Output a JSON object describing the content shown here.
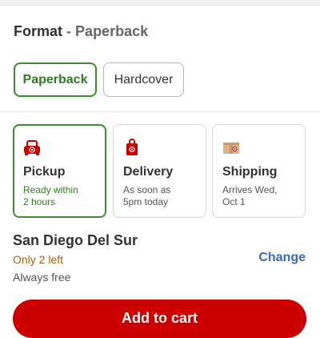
{
  "format": {
    "label": "Format",
    "separator": "-",
    "selected_value": "Paperback",
    "options": [
      "Paperback",
      "Hardcover"
    ]
  },
  "fulfillment": {
    "options": [
      {
        "title": "Pickup",
        "line1": "Ready within",
        "line2": "2 hours",
        "icon": "pickup-car-icon",
        "selected": true
      },
      {
        "title": "Delivery",
        "line1": "As soon as",
        "line2": "5pm today",
        "icon": "delivery-bag-icon",
        "selected": false
      },
      {
        "title": "Shipping",
        "line1": "Arrives Wed,",
        "line2": "Oct 1",
        "icon": "shipping-box-icon",
        "selected": false
      }
    ]
  },
  "store": {
    "name": "San Diego Del Sur",
    "stock": "Only 2 left",
    "change_label": "Change",
    "fee_note": "Always free"
  },
  "cart": {
    "button_label": "Add to cart"
  },
  "colors": {
    "selected_green": "#3e8e2f",
    "brand_red": "#cc0000",
    "link_blue": "#3b68c4",
    "stock_orange": "#a6620e"
  }
}
